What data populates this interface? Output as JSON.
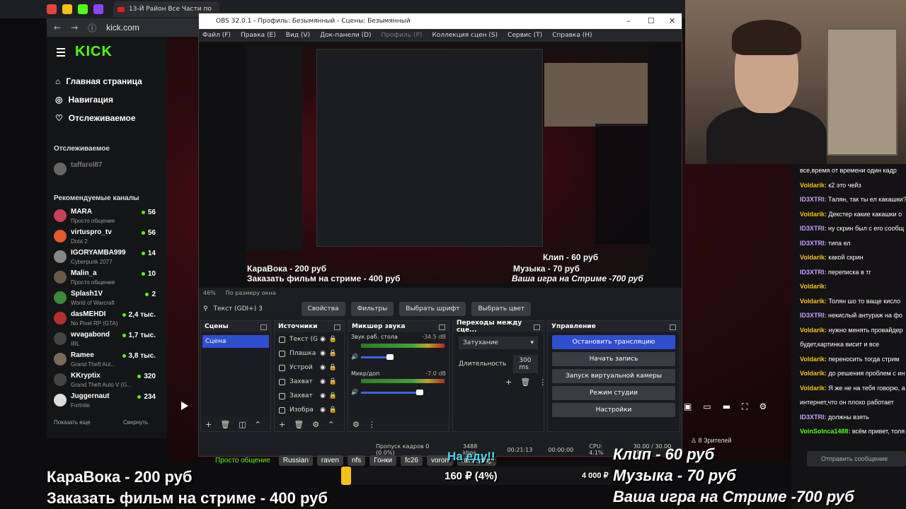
{
  "browser": {
    "tab_title": "13-Й Район Все Части по",
    "url": "kick.com"
  },
  "kick": {
    "nav": [
      "Главная страница",
      "Навигация",
      "Отслеживаемое"
    ],
    "followed_title": "Отслеживаемое",
    "followed_user": "taffarel87",
    "recommended_title": "Рекомендуемые каналы",
    "channels": [
      {
        "name": "MARA",
        "game": "Просто общение",
        "viewers": "56",
        "color": "#c8405a"
      },
      {
        "name": "virtuspro_tv",
        "game": "Dota 2",
        "viewers": "56",
        "color": "#e05a2a"
      },
      {
        "name": "IGORYAMBA999",
        "game": "Cyberpunk 2077",
        "viewers": "14",
        "color": "#888"
      },
      {
        "name": "Malin_a",
        "game": "Просто общение",
        "viewers": "10",
        "color": "#6a5a4a"
      },
      {
        "name": "Splash1V",
        "game": "World of Warcraft",
        "viewers": "2",
        "color": "#3a8a3a"
      },
      {
        "name": "dasMEHDI",
        "game": "No Pixel RP (GTA)",
        "viewers": "2,4 тыс.",
        "color": "#b03030"
      },
      {
        "name": "wvagabond",
        "game": "IRL",
        "viewers": "1,7 тыс.",
        "color": "#444"
      },
      {
        "name": "Ramee",
        "game": "Grand Theft Aut...",
        "viewers": "3,8 тыс.",
        "color": "#7a6a5a"
      },
      {
        "name": "KKryptix",
        "game": "Grand Theft Auto V (G...",
        "viewers": "320",
        "color": "#444"
      },
      {
        "name": "Juggernaut",
        "game": "Fortnite",
        "viewers": "234",
        "color": "#ddd"
      }
    ],
    "show_more": "Показать еще",
    "collapse": "Свернуть"
  },
  "obs": {
    "title": "OBS 32.0.1 - Профиль: Безымянный - Сцены: Безымянный",
    "menu": [
      "Файл (F)",
      "Правка (E)",
      "Вид (V)",
      "Док-панели (D)",
      "Профиль (P)",
      "Коллекция сцен (S)",
      "Сервис (T)",
      "Справка (H)"
    ],
    "zoom": "46%",
    "zoom_mode": "По размеру окна",
    "source_label": "Текст (GDI+) 3",
    "src_buttons": [
      "Свойства",
      "Фильтры",
      "Выбрать шрифт",
      "Выбрать цвет"
    ],
    "docks": {
      "scenes": "Сцены",
      "sources": "Источники",
      "mixer": "Микшер звука",
      "transitions": "Переходы между сце...",
      "controls": "Управление"
    },
    "scene_selected": "Сцена",
    "sources": [
      "Текст (G",
      "Плашка",
      "Устрой",
      "Захват",
      "Захват",
      "Изобра"
    ],
    "mixer": [
      {
        "name": "Звук раб. стола",
        "db": "-34.5 dB"
      },
      {
        "name": "Микр/доп",
        "db": "-7.0 dB"
      }
    ],
    "transition": "Затухание",
    "duration_label": "Длительность",
    "duration": "300 ms",
    "controls": [
      "Остановить трансляцию",
      "Начать запись",
      "Запуск виртуальной камеры",
      "Режим студии",
      "Настройки"
    ],
    "status": {
      "dropped": "Пропуск кадров 0 (0.0%)",
      "bitrate": "3488 kbps",
      "stream_time": "00:21:13",
      "rec_time": "00:00:00",
      "cpu": "CPU: 4.1%",
      "fps": "30.00 / 30.00 FPS"
    }
  },
  "overlay": {
    "left1": "КараВока - 200 руб",
    "left2": "Заказать фильм на стриме - 400 руб",
    "right1": "Клип - 60 руб",
    "right2": "Музыка - 70 руб",
    "right3": "Ваша игра на Стриме -700 руб",
    "goal_title": "На еду!!",
    "goal_current": "160 ₽ (4%)",
    "goal_target": "4 000 ₽",
    "category": "Просто общение",
    "tags": [
      "Russian",
      "raven",
      "nfs",
      "Гонки",
      "fc26",
      "voron",
      "ravenplay"
    ]
  },
  "player": {
    "viewers": "8 Зрителей"
  },
  "chat": {
    "messages": [
      {
        "user": "",
        "text": "все,время от времени один кадр",
        "color": "#fff"
      },
      {
        "user": "Voldarik:",
        "text": "к2 это чейз",
        "color": "#f2c21a"
      },
      {
        "user": "ID3XTRI:",
        "text": "Талян, так ты ел какашки?",
        "color": "#c8a0ff"
      },
      {
        "user": "Voldarik:",
        "text": "Декстер какие какашки о",
        "color": "#f2c21a"
      },
      {
        "user": "ID3XTRI:",
        "text": "ну скрин был с его сообщ",
        "color": "#c8a0ff"
      },
      {
        "user": "ID3XTRI:",
        "text": "типа ел",
        "color": "#c8a0ff"
      },
      {
        "user": "Voldarik:",
        "text": "какой скрин",
        "color": "#f2c21a"
      },
      {
        "user": "ID3XTRI:",
        "text": "переписка в тг",
        "color": "#c8a0ff"
      },
      {
        "user": "Voldarik:",
        "text": "",
        "color": "#f2c21a"
      },
      {
        "user": "Voldarik:",
        "text": "Толян шо то ваще кисло",
        "color": "#f2c21a"
      },
      {
        "user": "ID3XTRI:",
        "text": "некислый антураж на фо",
        "color": "#c8a0ff"
      },
      {
        "user": "Voldarik:",
        "text": "нужно менять провайдер",
        "color": "#f2c21a"
      },
      {
        "user": "",
        "text": "будет,картинка висит и все",
        "color": "#fff"
      },
      {
        "user": "Voldarik:",
        "text": "переносить тогда стрим",
        "color": "#f2c21a"
      },
      {
        "user": "Voldarik:",
        "text": "до решения проблем с ин",
        "color": "#f2c21a"
      },
      {
        "user": "Voldarik:",
        "text": "Я же не на тебя говорю, а",
        "color": "#f2c21a"
      },
      {
        "user": "",
        "text": "интернет,что он плохо работает",
        "color": "#fff"
      },
      {
        "user": "ID3XTRI:",
        "text": "должны взять",
        "color": "#c8a0ff"
      },
      {
        "user": "VoinSolnca1488:",
        "text": "всём привет, толя",
        "color": "#53fc18"
      }
    ],
    "input_placeholder": "Отправить сообщение"
  }
}
